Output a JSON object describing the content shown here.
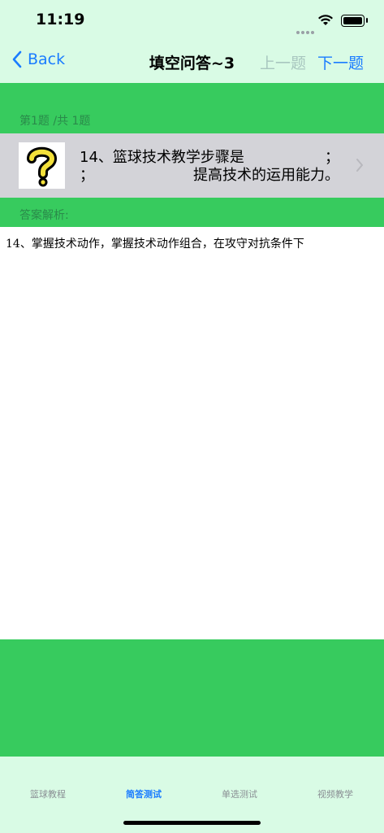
{
  "status": {
    "time": "11:19"
  },
  "nav": {
    "back_label": "Back",
    "title": "填空问答~3",
    "prev_label": "上一题",
    "next_label": "下一题"
  },
  "counter": "第1题 /共 1题",
  "question": {
    "line1": "14、篮球技术教学步骤是",
    "line1_end": "；",
    "line2_start": "；",
    "line2_end": "提高技术的运用能力。"
  },
  "answer_label": "答案解析:",
  "answer_text": "14、掌握技术动作，掌握技术动作组合，在攻守对抗条件下",
  "tabs": [
    {
      "label": "篮球教程"
    },
    {
      "label": "简答测试"
    },
    {
      "label": "单选测试"
    },
    {
      "label": "视频教学"
    }
  ],
  "colors": {
    "accent": "#1a7cff",
    "green": "#37cb5e",
    "mint": "#d9fbe5"
  }
}
